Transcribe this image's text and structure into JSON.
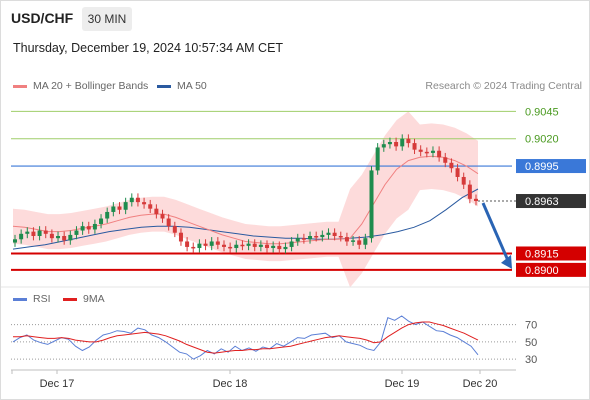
{
  "header": {
    "symbol": "USD/CHF",
    "timeframe": "30 MIN",
    "datetime": "Thursday, December 19, 2024 10:57:34 AM CET"
  },
  "legend": {
    "ma20": {
      "label": "MA 20 + Bollinger Bands",
      "color": "#f08080"
    },
    "ma50": {
      "label": "MA 50",
      "color": "#2a5aa0"
    },
    "rsi": {
      "label": "RSI",
      "color": "#5b7fd6"
    },
    "ma9": {
      "label": "9MA",
      "color": "#e02020"
    }
  },
  "credit": "Research © 2024 Trading Central",
  "colors": {
    "up": "#1e8c4e",
    "down": "#d63a3a",
    "resistance": "#9fce6a",
    "pivot": "#3a78d8",
    "support": "#d40000",
    "current": "#333333",
    "arrow": "#2a64b4"
  },
  "chart_data": [
    {
      "type": "line",
      "description_of_content": "USD/CHF 30-minute candlestick price chart with MA20, Bollinger Bands, MA50, key levels and projected arrow",
      "x_tick_labels": [
        "Dec 17",
        "Dec 18",
        "Dec 19",
        "Dec 20"
      ],
      "ylim": [
        0.8888,
        0.906
      ],
      "levels": [
        {
          "label": "0.9045",
          "value": 0.9045,
          "kind": "resistance"
        },
        {
          "label": "0.9020",
          "value": 0.902,
          "kind": "resistance"
        },
        {
          "label": "0.8995",
          "value": 0.8995,
          "kind": "pivot"
        },
        {
          "label": "0.8963",
          "value": 0.8963,
          "kind": "current"
        },
        {
          "label": "0.8915",
          "value": 0.8915,
          "kind": "support"
        },
        {
          "label": "0.8900",
          "value": 0.89,
          "kind": "support"
        }
      ],
      "close_series": [
        0.8928,
        0.8933,
        0.8935,
        0.8931,
        0.8936,
        0.8933,
        0.8929,
        0.8931,
        0.8927,
        0.8932,
        0.8936,
        0.894,
        0.8937,
        0.8942,
        0.8947,
        0.8953,
        0.8958,
        0.8955,
        0.8962,
        0.8966,
        0.8962,
        0.896,
        0.8956,
        0.8951,
        0.8947,
        0.894,
        0.8934,
        0.8926,
        0.8921,
        0.892,
        0.8924,
        0.8922,
        0.8926,
        0.8923,
        0.8921,
        0.892,
        0.8923,
        0.8922,
        0.8924,
        0.8921,
        0.8923,
        0.892,
        0.8922,
        0.8919,
        0.8921,
        0.8926,
        0.8929,
        0.8928,
        0.8931,
        0.893,
        0.8932,
        0.8934,
        0.8931,
        0.893,
        0.8926,
        0.8927,
        0.8923,
        0.8929,
        0.8991,
        0.9012,
        0.9015,
        0.9017,
        0.9013,
        0.902,
        0.9016,
        0.901,
        0.9008,
        0.9007,
        0.9009,
        0.9003,
        0.8998,
        0.8993,
        0.8985,
        0.8978,
        0.8965,
        0.8963
      ],
      "ma20_series": [
        0.894,
        0.8939,
        0.8937,
        0.8935,
        0.8935,
        0.8936,
        0.8938,
        0.894,
        0.8942,
        0.8945,
        0.8948,
        0.895,
        0.8951,
        0.8951,
        0.8948,
        0.8944,
        0.894,
        0.8936,
        0.8932,
        0.8929,
        0.8926,
        0.8925,
        0.8924,
        0.8924,
        0.8925,
        0.8926,
        0.8927,
        0.8928,
        0.8928,
        0.8929,
        0.8942,
        0.896,
        0.8978,
        0.8992,
        0.9,
        0.9003,
        0.9004,
        0.9003,
        0.9,
        0.8995,
        0.8988
      ],
      "ma50_series": [
        0.8919,
        0.8921,
        0.8923,
        0.8926,
        0.8929,
        0.8932,
        0.8935,
        0.8937,
        0.8939,
        0.894,
        0.894,
        0.8939,
        0.8937,
        0.8935,
        0.8933,
        0.8931,
        0.893,
        0.8929,
        0.8929,
        0.8928,
        0.8928,
        0.8929,
        0.893,
        0.8932,
        0.8935,
        0.8939,
        0.8945,
        0.8955,
        0.8966,
        0.8974
      ]
    },
    {
      "type": "line",
      "description_of_content": "RSI oscillator with 9-period moving average",
      "ylim": [
        22,
        80
      ],
      "y_ticks": [
        70,
        50,
        30
      ],
      "rsi_series": [
        50,
        55,
        58,
        52,
        49,
        47,
        51,
        55,
        53,
        45,
        40,
        44,
        52,
        58,
        60,
        63,
        62,
        60,
        66,
        64,
        58,
        55,
        50,
        44,
        38,
        36,
        30,
        34,
        40,
        36,
        42,
        38,
        45,
        40,
        43,
        39,
        44,
        42,
        48,
        45,
        50,
        55,
        54,
        58,
        59,
        60,
        55,
        57,
        50,
        48,
        46,
        42,
        40,
        50,
        78,
        75,
        80,
        74,
        70,
        73,
        68,
        63,
        62,
        58,
        55,
        50,
        45,
        35
      ],
      "ma9_series": [
        56,
        56,
        57,
        56,
        55,
        54,
        54,
        55,
        54,
        52,
        51,
        50,
        50,
        52,
        55,
        57,
        58,
        59,
        60,
        61,
        60,
        59,
        57,
        54,
        51,
        47,
        44,
        41,
        38,
        37,
        38,
        39,
        40,
        40,
        41,
        41,
        42,
        42,
        43,
        44,
        45,
        47,
        49,
        51,
        53,
        55,
        56,
        57,
        56,
        55,
        54,
        52,
        49,
        50,
        56,
        61,
        66,
        70,
        72,
        73,
        73,
        71,
        69,
        66,
        63,
        60,
        56,
        52
      ]
    }
  ]
}
